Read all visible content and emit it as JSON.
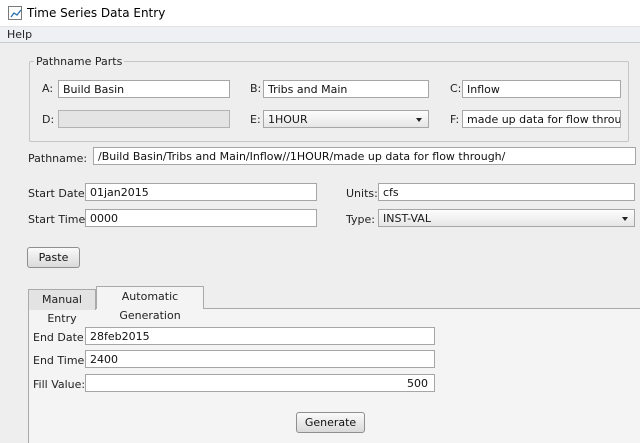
{
  "window": {
    "title": "Time Series Data Entry",
    "icon": "app-window-icon"
  },
  "menu": {
    "items": [
      "Help"
    ]
  },
  "pathname_parts": {
    "title": "Pathname Parts",
    "a": {
      "label": "A:",
      "value": "Build Basin"
    },
    "b": {
      "label": "B:",
      "value": "Tribs and Main"
    },
    "c": {
      "label": "C:",
      "value": "Inflow"
    },
    "d": {
      "label": "D:",
      "value": ""
    },
    "e": {
      "label": "E:",
      "value": "1HOUR"
    },
    "f": {
      "label": "F:",
      "value": "made up data for flow through"
    }
  },
  "pathname": {
    "label": "Pathname:",
    "value": "/Build Basin/Tribs and Main/Inflow//1HOUR/made up data for flow through/"
  },
  "start_date": {
    "label": "Start Date:",
    "value": "01jan2015"
  },
  "start_time": {
    "label": "Start Time:",
    "value": "0000"
  },
  "units": {
    "label": "Units:",
    "value": "cfs"
  },
  "type": {
    "label": "Type:",
    "value": "INST-VAL"
  },
  "paste_button": "Paste",
  "tabs": [
    {
      "label": "Manual Entry",
      "active": false
    },
    {
      "label": "Automatic Generation",
      "active": true
    }
  ],
  "auto_gen": {
    "end_date": {
      "label": "End Date:",
      "value": "28feb2015"
    },
    "end_time": {
      "label": "End Time:",
      "value": "2400"
    },
    "fill_value": {
      "label": "Fill Value:",
      "value": "500"
    },
    "generate_button": "Generate"
  }
}
